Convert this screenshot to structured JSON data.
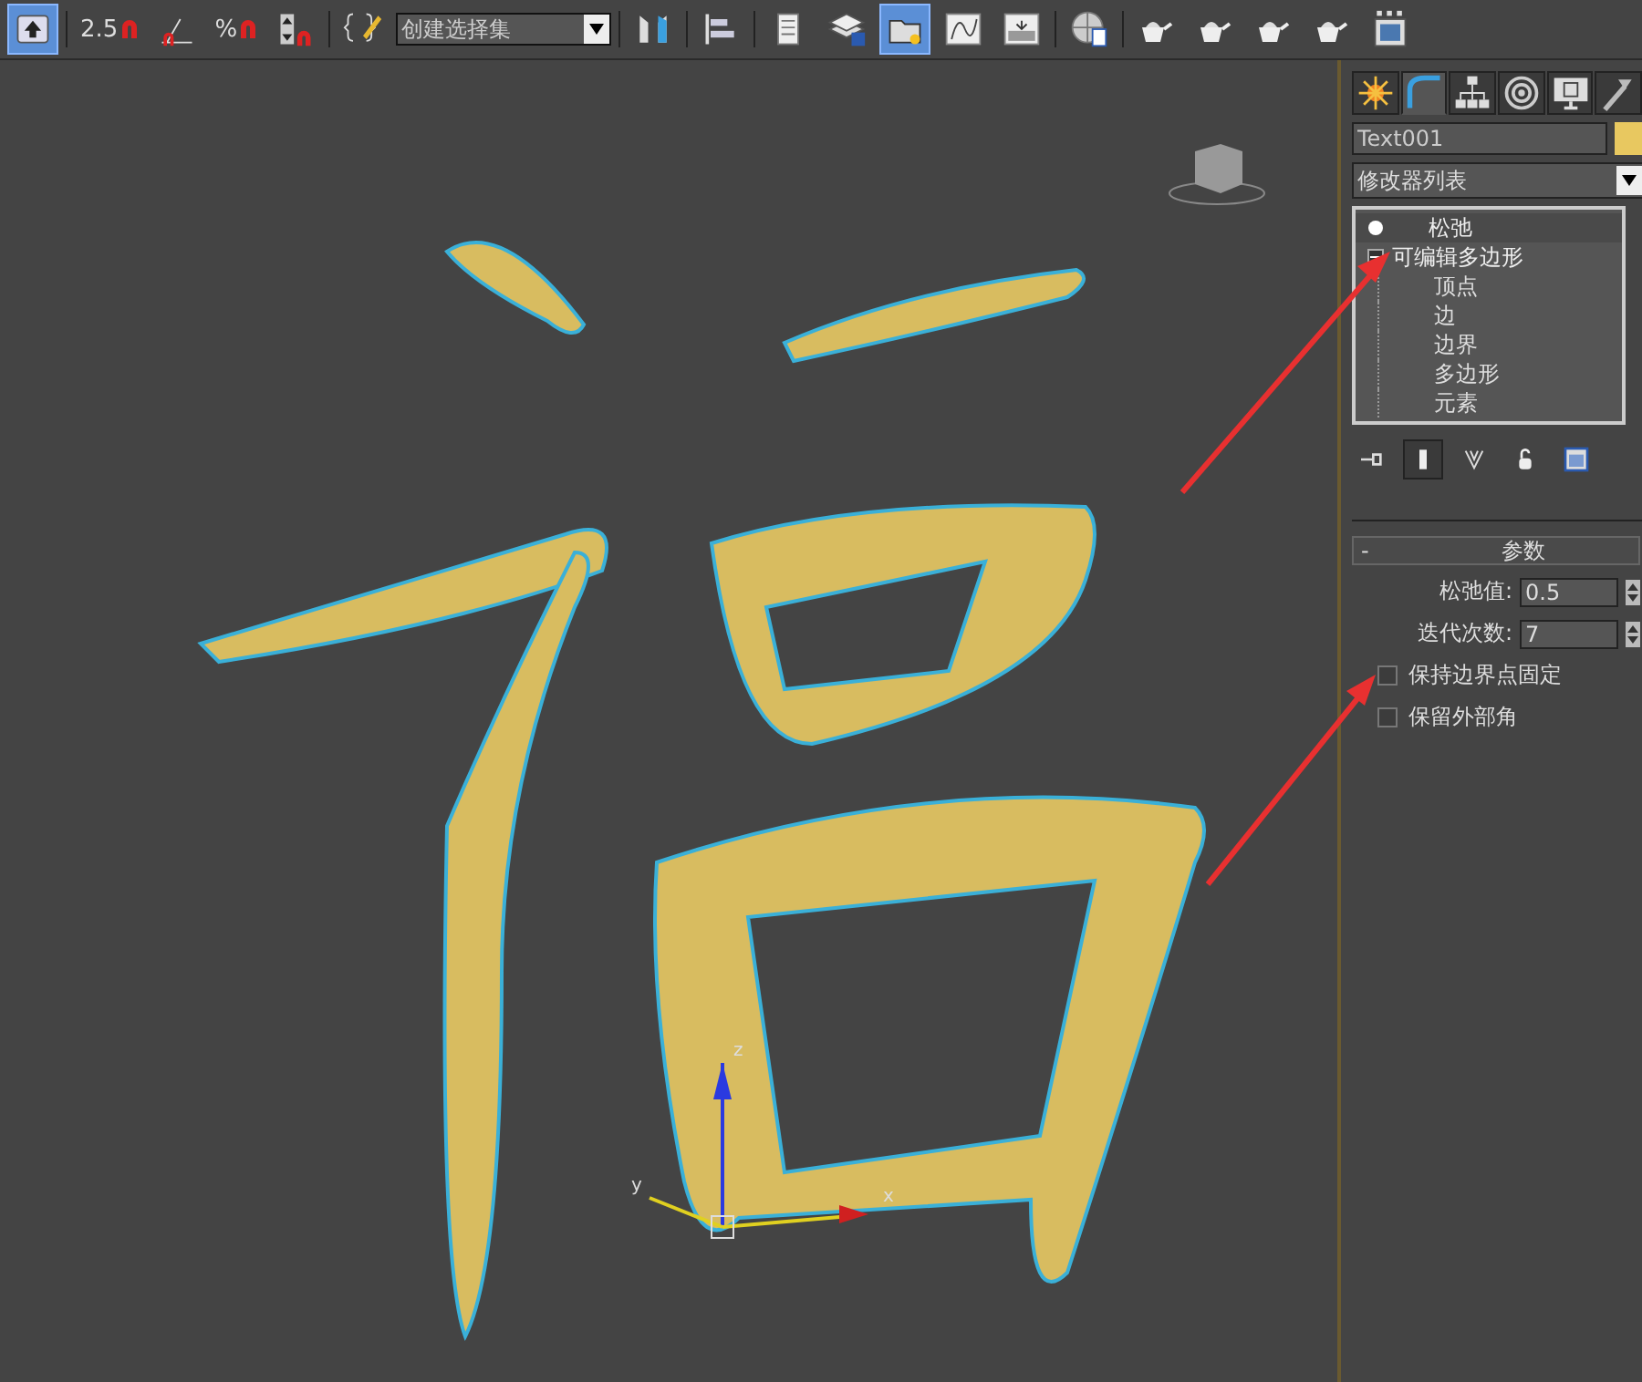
{
  "toolbar": {
    "buttons": [
      {
        "kind": "upload",
        "active": true
      },
      {
        "kind": "snap",
        "label": "2.5",
        "active": false
      },
      {
        "kind": "angle-snap",
        "active": false
      },
      {
        "kind": "snap",
        "label": "%",
        "active": false
      },
      {
        "kind": "spinner-snap",
        "active": false
      },
      {
        "kind": "edit-named-sets",
        "active": false
      }
    ],
    "selection_set": {
      "value": "创建选择集"
    },
    "buttons_after": [
      {
        "kind": "mirror",
        "active": false
      },
      {
        "kind": "align",
        "active": false
      },
      {
        "kind": "list",
        "active": false
      },
      {
        "kind": "layers",
        "active": false
      },
      {
        "kind": "folder",
        "active": true
      },
      {
        "kind": "curve",
        "active": false
      },
      {
        "kind": "dialog",
        "active": false
      },
      {
        "kind": "globe",
        "active": false
      },
      {
        "kind": "teapot",
        "active": false
      },
      {
        "kind": "teapot",
        "active": false
      },
      {
        "kind": "teapot",
        "active": false
      },
      {
        "kind": "teapot",
        "active": false
      },
      {
        "kind": "frame",
        "active": false
      }
    ]
  },
  "viewport": {
    "axes": [
      "x",
      "y",
      "z"
    ]
  },
  "panel": {
    "tabs": [
      {
        "kind": "create",
        "selected": false
      },
      {
        "kind": "modify",
        "selected": true
      },
      {
        "kind": "hierarchy",
        "selected": false
      },
      {
        "kind": "motion",
        "selected": false
      },
      {
        "kind": "display",
        "selected": false
      },
      {
        "kind": "utilities",
        "selected": false
      }
    ],
    "object_name": "Text001",
    "modifier_list": "修改器列表",
    "stack": [
      {
        "label": "松弛",
        "kind": "modifier"
      },
      {
        "label": "可编辑多边形",
        "kind": "base",
        "expanded": true,
        "children": [
          {
            "label": "顶点"
          },
          {
            "label": "边"
          },
          {
            "label": "边界"
          },
          {
            "label": "多边形"
          },
          {
            "label": "元素"
          }
        ]
      }
    ],
    "stack_tools": [
      {
        "kind": "pin",
        "active": false
      },
      {
        "kind": "show-end",
        "active": true
      },
      {
        "kind": "unique",
        "active": false
      },
      {
        "kind": "remove",
        "active": false
      },
      {
        "kind": "configure",
        "active": false
      }
    ],
    "rollout": {
      "collapse": "-",
      "title": "参数",
      "fields": [
        {
          "label": "松弛值:",
          "value": "0.5"
        },
        {
          "label": "迭代次数:",
          "value": "7"
        }
      ],
      "checkboxes": [
        {
          "label": "保持边界点固定",
          "checked": false
        },
        {
          "label": "保留外部角",
          "checked": false
        }
      ]
    }
  },
  "annotations": [
    {
      "kind": "arrow"
    },
    {
      "kind": "arrow"
    }
  ]
}
